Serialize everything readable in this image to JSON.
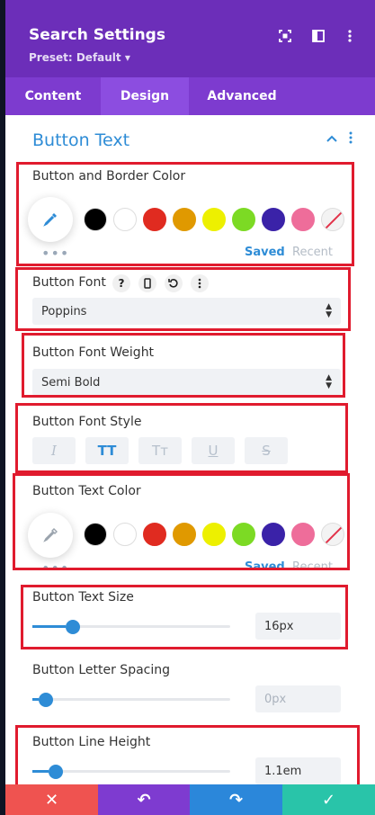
{
  "header": {
    "title": "Search Settings",
    "preset": "Preset: Default ▾",
    "icons": [
      "expand-icon",
      "split-view-icon",
      "more-vertical-icon"
    ]
  },
  "tabs": [
    {
      "label": "Content",
      "active": false
    },
    {
      "label": "Design",
      "active": true
    },
    {
      "label": "Advanced",
      "active": false
    }
  ],
  "section": {
    "title": "Button Text"
  },
  "fields": {
    "border_color": {
      "label": "Button and Border Color",
      "saved": "Saved",
      "recent": "Recent"
    },
    "font": {
      "label": "Button Font",
      "icons": [
        "help-icon",
        "mobile-icon",
        "reset-icon",
        "more-vertical-icon"
      ],
      "value": "Poppins"
    },
    "font_weight": {
      "label": "Button Font Weight",
      "value": "Semi Bold"
    },
    "font_style": {
      "label": "Button Font Style",
      "options": [
        {
          "glyph": "I",
          "name": "italic",
          "active": false
        },
        {
          "glyph": "TT",
          "name": "uppercase",
          "active": true
        },
        {
          "glyph": "Tт",
          "name": "capitalize",
          "active": false
        },
        {
          "glyph": "U",
          "name": "underline",
          "active": false
        },
        {
          "glyph": "S",
          "name": "strikethrough",
          "active": false
        }
      ]
    },
    "text_color": {
      "label": "Button Text Color",
      "saved": "Saved",
      "recent": "Recent"
    },
    "text_size": {
      "label": "Button Text Size",
      "value": "16px",
      "slider_fraction": 0.17
    },
    "letter_spacing": {
      "label": "Button Letter Spacing",
      "value": "0px",
      "slider_fraction": 0.03
    },
    "line_height": {
      "label": "Button Line Height",
      "value": "1.1em",
      "slider_fraction": 0.08
    }
  },
  "swatches": [
    "#000000",
    "#ffffff",
    "#e02b20",
    "#e09900",
    "#edf000",
    "#7cda24",
    "#3a22a8",
    "#ee6d9a",
    "none"
  ],
  "colors": {
    "header": "#6c2eb9",
    "tabs": "#7d3bcf",
    "accent": "#2e8cd6",
    "highlight": "#e01b2e"
  },
  "bottom_bar": [
    {
      "name": "cancel-button",
      "glyph": "✕",
      "color": "#ef5350"
    },
    {
      "name": "undo-button",
      "glyph": "↶",
      "color": "#7e3bd0"
    },
    {
      "name": "redo-button",
      "glyph": "↷",
      "color": "#2b87da"
    },
    {
      "name": "save-button",
      "glyph": "✓",
      "color": "#29c4a9"
    }
  ]
}
